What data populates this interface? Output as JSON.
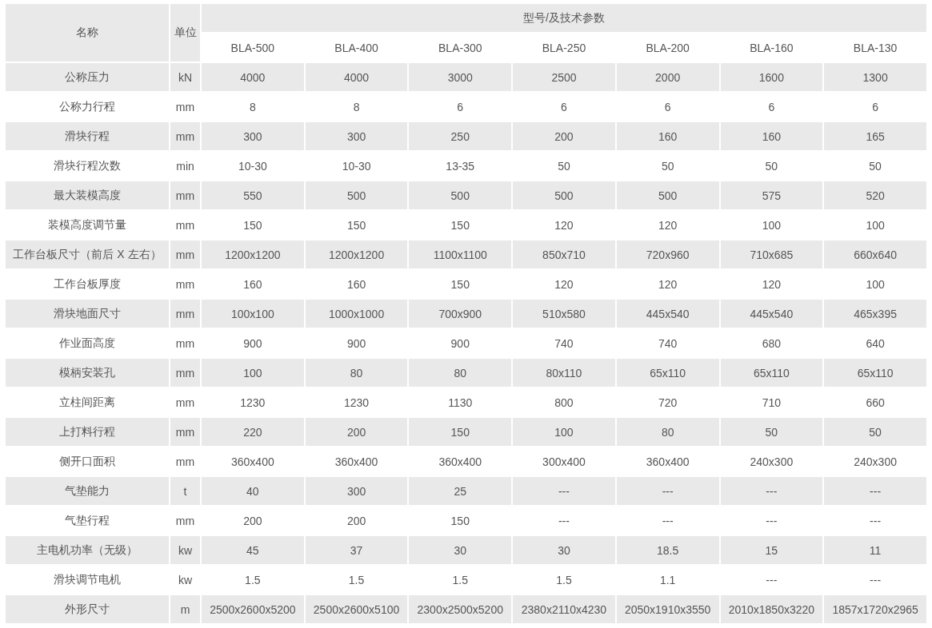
{
  "table": {
    "columns": {
      "name": "名称",
      "unit": "单位",
      "group": "型号/及技术参数",
      "models": [
        "BLA-500",
        "BLA-400",
        "BLA-300",
        "BLA-250",
        "BLA-200",
        "BLA-160",
        "BLA-130"
      ]
    },
    "rows": [
      {
        "name": "公称压力",
        "unit": "kN",
        "values": [
          "4000",
          "4000",
          "3000",
          "2500",
          "2000",
          "1600",
          "1300"
        ]
      },
      {
        "name": "公称力行程",
        "unit": "mm",
        "values": [
          "8",
          "8",
          "6",
          "6",
          "6",
          "6",
          "6"
        ]
      },
      {
        "name": "滑块行程",
        "unit": "mm",
        "values": [
          "300",
          "300",
          "250",
          "200",
          "160",
          "160",
          "165"
        ]
      },
      {
        "name": "滑块行程次数",
        "unit": "min",
        "values": [
          "10-30",
          "10-30",
          "13-35",
          "50",
          "50",
          "50",
          "50"
        ]
      },
      {
        "name": "最大装模高度",
        "unit": "mm",
        "values": [
          "550",
          "500",
          "500",
          "500",
          "500",
          "575",
          "520"
        ]
      },
      {
        "name": "装模高度调节量",
        "unit": "mm",
        "values": [
          "150",
          "150",
          "150",
          "120",
          "120",
          "100",
          "100"
        ]
      },
      {
        "name": "工作台板尺寸（前后 X 左右）",
        "unit": "mm",
        "values": [
          "1200x1200",
          "1200x1200",
          "1100x1100",
          "850x710",
          "720x960",
          "710x685",
          "660x640"
        ]
      },
      {
        "name": "工作台板厚度",
        "unit": "mm",
        "values": [
          "160",
          "160",
          "150",
          "120",
          "120",
          "120",
          "100"
        ]
      },
      {
        "name": "滑块地面尺寸",
        "unit": "mm",
        "values": [
          "100x100",
          "1000x1000",
          "700x900",
          "510x580",
          "445x540",
          "445x540",
          "465x395"
        ]
      },
      {
        "name": "作业面高度",
        "unit": "mm",
        "values": [
          "900",
          "900",
          "900",
          "740",
          "740",
          "680",
          "640"
        ]
      },
      {
        "name": "模柄安装孔",
        "unit": "mm",
        "values": [
          "100",
          "80",
          "80",
          "80x110",
          "65x110",
          "65x110",
          "65x110"
        ]
      },
      {
        "name": "立柱间距离",
        "unit": "mm",
        "values": [
          "1230",
          "1230",
          "1130",
          "800",
          "720",
          "710",
          "660"
        ]
      },
      {
        "name": "上打料行程",
        "unit": "mm",
        "values": [
          "220",
          "200",
          "150",
          "100",
          "80",
          "50",
          "50"
        ]
      },
      {
        "name": "侧开口面积",
        "unit": "mm",
        "values": [
          "360x400",
          "360x400",
          "360x400",
          "300x400",
          "360x400",
          "240x300",
          "240x300"
        ]
      },
      {
        "name": "气垫能力",
        "unit": "t",
        "values": [
          "40",
          "300",
          "25",
          "---",
          "---",
          "---",
          "---"
        ]
      },
      {
        "name": "气垫行程",
        "unit": "mm",
        "values": [
          "200",
          "200",
          "150",
          "---",
          "---",
          "---",
          "---"
        ]
      },
      {
        "name": "主电机功率（无级）",
        "unit": "kw",
        "values": [
          "45",
          "37",
          "30",
          "30",
          "18.5",
          "15",
          "11"
        ]
      },
      {
        "name": "滑块调节电机",
        "unit": "kw",
        "values": [
          "1.5",
          "1.5",
          "1.5",
          "1.5",
          "1.1",
          "---",
          "---"
        ]
      },
      {
        "name": "外形尺寸",
        "unit": "m",
        "values": [
          "2500x2600x5200",
          "2500x2600x5100",
          "2300x2500x5200",
          "2380x2110x4230",
          "2050x1910x3550",
          "2010x1850x3220",
          "1857x1720x2965"
        ]
      }
    ]
  }
}
